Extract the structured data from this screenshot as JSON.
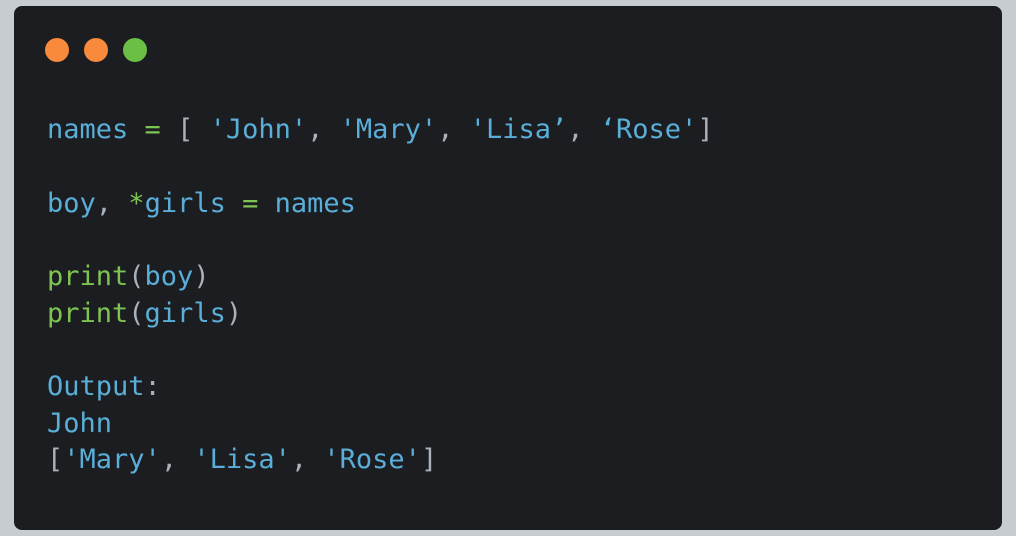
{
  "colors": {
    "page_bg": "#c7ccd0",
    "window_bg": "#1b1d21",
    "close": "#f98a3c",
    "minimize": "#f98a3c",
    "maximize": "#6cbf45",
    "ident": "#5aaed8",
    "operator": "#7ec450",
    "punct": "#a9b2bb",
    "string": "#5aaed8"
  },
  "window": {
    "icons": [
      "close-dot",
      "minimize-dot",
      "maximize-dot"
    ]
  },
  "code": {
    "lines": [
      [
        {
          "t": "names",
          "c": "ident"
        },
        {
          "t": " ",
          "c": "punct"
        },
        {
          "t": "=",
          "c": "operator"
        },
        {
          "t": " [ ",
          "c": "punct"
        },
        {
          "t": "'John'",
          "c": "string"
        },
        {
          "t": ", ",
          "c": "punct"
        },
        {
          "t": "'Mary'",
          "c": "string"
        },
        {
          "t": ", ",
          "c": "punct"
        },
        {
          "t": "'Lisa’",
          "c": "string"
        },
        {
          "t": ", ",
          "c": "punct"
        },
        {
          "t": "‘Rose'",
          "c": "string"
        },
        {
          "t": "]",
          "c": "punct"
        }
      ],
      [],
      [
        {
          "t": "boy",
          "c": "ident"
        },
        {
          "t": ", ",
          "c": "punct"
        },
        {
          "t": "*",
          "c": "operator"
        },
        {
          "t": "girls",
          "c": "ident"
        },
        {
          "t": " ",
          "c": "punct"
        },
        {
          "t": "=",
          "c": "operator"
        },
        {
          "t": " ",
          "c": "punct"
        },
        {
          "t": "names",
          "c": "ident"
        }
      ],
      [],
      [
        {
          "t": "print",
          "c": "operator"
        },
        {
          "t": "(",
          "c": "punct"
        },
        {
          "t": "boy",
          "c": "ident"
        },
        {
          "t": ")",
          "c": "punct"
        }
      ],
      [
        {
          "t": "print",
          "c": "operator"
        },
        {
          "t": "(",
          "c": "punct"
        },
        {
          "t": "girls",
          "c": "ident"
        },
        {
          "t": ")",
          "c": "punct"
        }
      ],
      [],
      [
        {
          "t": "Output",
          "c": "ident"
        },
        {
          "t": ":",
          "c": "punct"
        }
      ],
      [
        {
          "t": "John",
          "c": "ident"
        }
      ],
      [
        {
          "t": "[",
          "c": "punct"
        },
        {
          "t": "'Mary'",
          "c": "string"
        },
        {
          "t": ", ",
          "c": "punct"
        },
        {
          "t": "'Lisa'",
          "c": "string"
        },
        {
          "t": ", ",
          "c": "punct"
        },
        {
          "t": "'Rose'",
          "c": "string"
        },
        {
          "t": "]",
          "c": "punct"
        }
      ]
    ]
  }
}
